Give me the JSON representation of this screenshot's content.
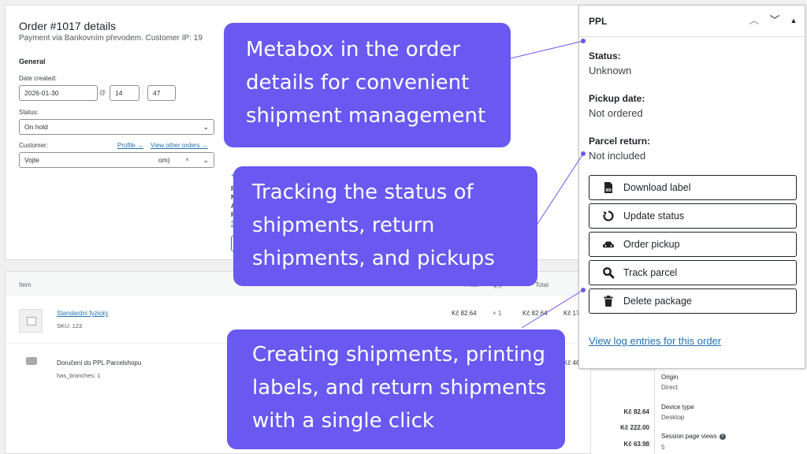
{
  "order": {
    "title": "Order #1017 details",
    "subtitle": "Payment via Bankovním převodem. Customer IP: 19",
    "section": "General",
    "date_label": "Date created:",
    "date_value": "2026-01-30",
    "at": "@",
    "hour": "14",
    "colon": ":",
    "minute": "47",
    "status_label": "Status:",
    "status_value": "On hold",
    "customer_label": "Customer:",
    "profile_link": "Profile →",
    "view_orders_link": "View other orders →",
    "customer_value": "Vojte",
    "customer_tail": "om)",
    "clear": "×",
    "partial_phone": "+42",
    "partial_lines": [
      "PP",
      "Na",
      "Ad",
      "Po"
    ],
    "partial_link": "Sh"
  },
  "items": {
    "col_item": "Item",
    "col_price": "Price",
    "col_qty": "Qty",
    "col_total": "Total",
    "rows": [
      {
        "name": "Standardní fyzický",
        "sku": "SKU: 123",
        "price": "Kč 82.64",
        "qty": "× 1",
        "total": "Kč 82.64",
        "extra": "Kč 17"
      },
      {
        "name": "Doručení do PPL Parcelshopu",
        "meta": "has_branches: 1",
        "extra": "Kč 46"
      }
    ],
    "totals": [
      "Kč 82.64",
      "Kč 222.00",
      "Kč 63.98"
    ]
  },
  "side_lower": {
    "origin_label": "Origin",
    "origin_value": "Direct",
    "device_label": "Device type",
    "device_value": "Desktop",
    "views_label": "Session page views",
    "views_value": "5"
  },
  "ppl": {
    "title": "PPL",
    "up": "︿",
    "down": "﹀",
    "toggle": "▲",
    "status_label": "Status:",
    "status_value": "Unknown",
    "pickup_label": "Pickup date:",
    "pickup_value": "Not ordered",
    "return_label": "Parcel return:",
    "return_value": "Not included",
    "buttons": [
      {
        "label": "Download label",
        "icon": "pdf-icon"
      },
      {
        "label": "Update status",
        "icon": "refresh-icon"
      },
      {
        "label": "Order pickup",
        "icon": "car-icon"
      },
      {
        "label": "Track parcel",
        "icon": "search-icon"
      },
      {
        "label": "Delete package",
        "icon": "trash-icon"
      }
    ],
    "log_link": "View log entries for this order"
  },
  "callouts": {
    "c1": [
      "Metabox in the order",
      "details for convenient",
      "shipment management"
    ],
    "c2": [
      "Tracking the status of",
      "shipments, return",
      "shipments, and pickups"
    ],
    "c3": [
      "Creating shipments, printing",
      "labels, and return shipments",
      "with a single click"
    ]
  },
  "colors": {
    "callout": "#6959f0",
    "link": "#2271b1",
    "connector": "#6959f0"
  }
}
